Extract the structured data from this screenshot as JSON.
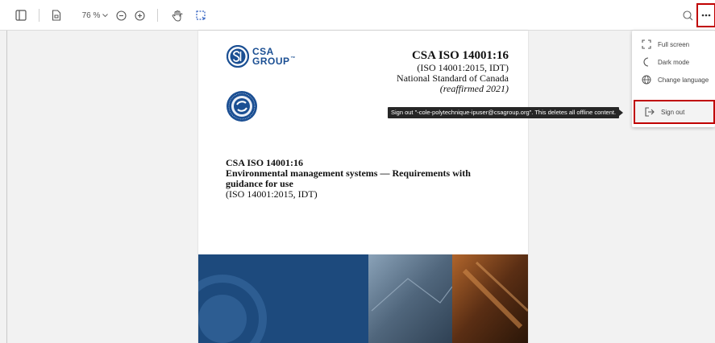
{
  "toolbar": {
    "zoom_value": "76 %",
    "icons": [
      "sidebar-toggle-icon",
      "page-fit-icon",
      "chevron-down-icon",
      "zoom-out-icon",
      "zoom-in-icon",
      "hand-tool-icon",
      "selection-tool-icon",
      "search-icon",
      "more-options-icon"
    ]
  },
  "document": {
    "logo_text_line1": "CSA",
    "logo_text_line2": "GROUP",
    "logo_tm": "™",
    "standard_code": "CSA ISO 14001:16",
    "standard_equiv": "(ISO 14001:2015, IDT)",
    "standard_national": "National Standard of Canada",
    "standard_reaffirmed": "(reaffirmed 2021)",
    "title_code": "CSA ISO 14001:16",
    "title_line1": "Environmental management systems — Requirements with",
    "title_line2": "guidance for use",
    "title_equiv": "(ISO 14001:2015, IDT)"
  },
  "tooltip": {
    "text": "Sign out \"-cole-polytechnique-ipuser@csagroup.org\". This deletes all offline content."
  },
  "menu": {
    "items": [
      {
        "label": "Full screen",
        "icon": "fullscreen-icon"
      },
      {
        "label": "Dark mode",
        "icon": "moon-icon"
      },
      {
        "label": "Change language",
        "icon": "globe-icon"
      },
      {
        "label": "Sign out",
        "icon": "sign-out-icon"
      }
    ]
  },
  "colors": {
    "highlight": "#c00000",
    "brand_blue": "#1b4f93",
    "tooltip_bg": "#262626"
  }
}
